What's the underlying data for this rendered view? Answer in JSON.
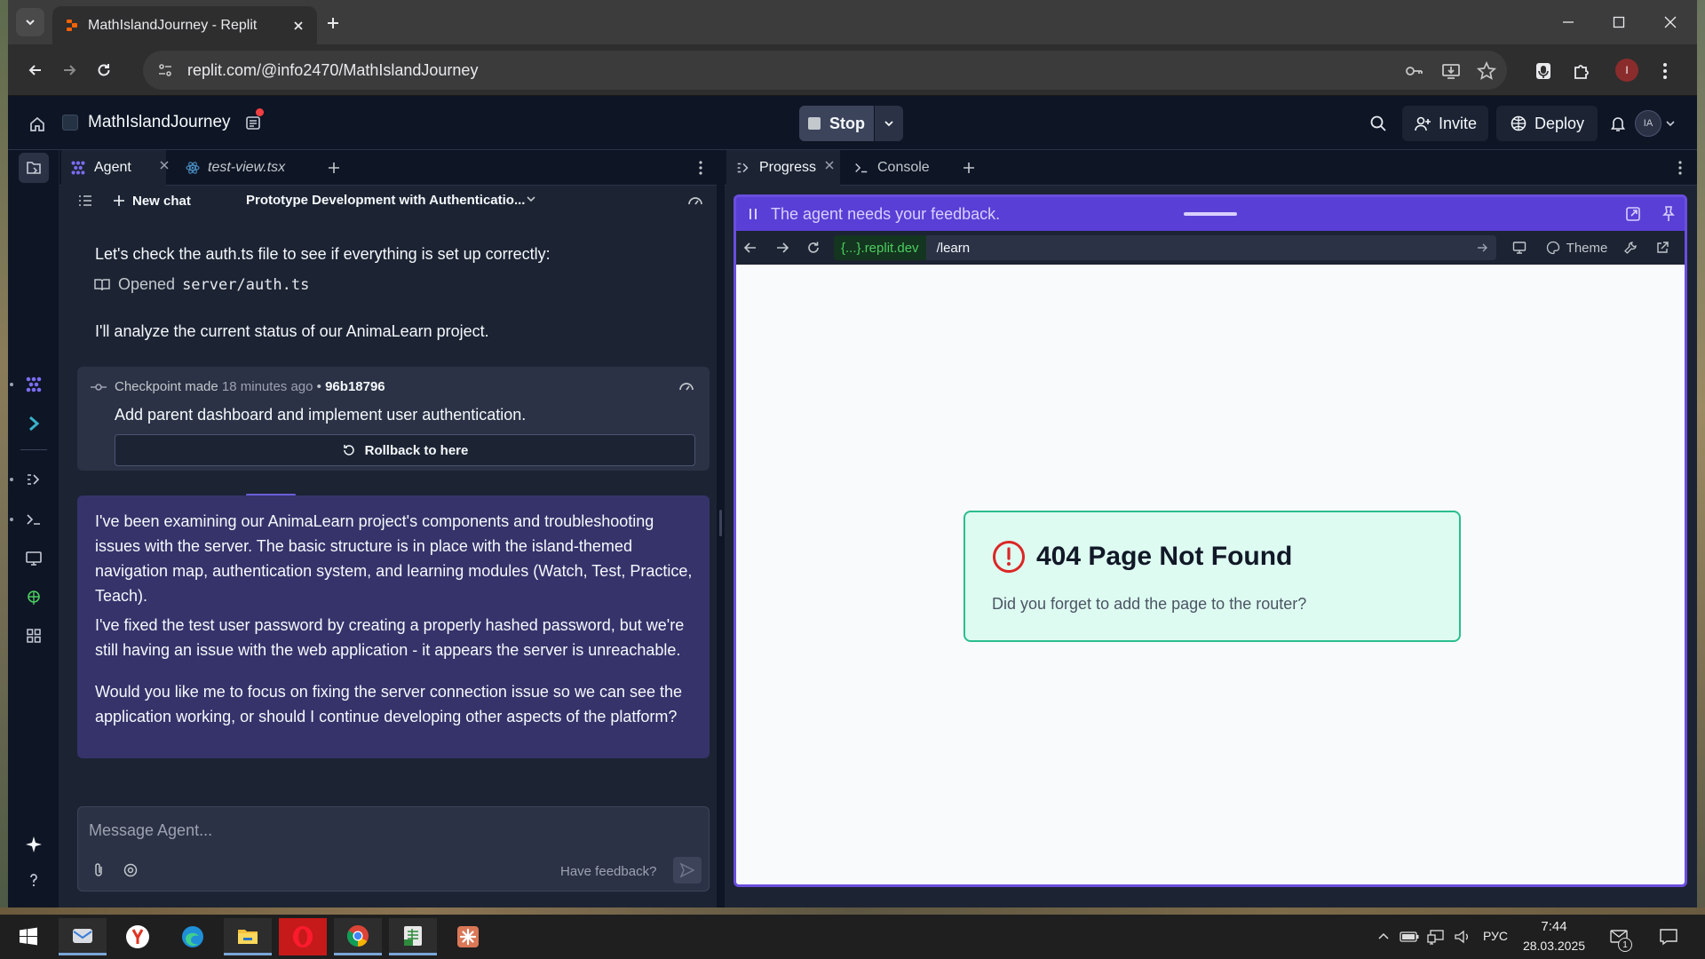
{
  "browser": {
    "tab_title": "MathIslandJourney - Replit",
    "url": "replit.com/@info2470/MathIslandJourney",
    "profile_initial": "I"
  },
  "replit_header": {
    "repl_name": "MathIslandJourney",
    "stop_label": "Stop",
    "invite_label": "Invite",
    "deploy_label": "Deploy",
    "avatar_initials": "IA"
  },
  "left_panel": {
    "tabs": [
      {
        "label": "Agent",
        "icon": "agent-icon"
      },
      {
        "label": "test-view.tsx",
        "icon": "react-file-icon"
      }
    ],
    "new_chat_label": "New chat",
    "chat_title": "Prototype Development with Authenticatio..."
  },
  "chat": {
    "msg_check": "Let's check the auth.ts file to see if everything is set up correctly:",
    "opened_label": "Opened",
    "opened_file": "server/auth.ts",
    "msg_analyze": "I'll analyze the current status of our AnimaLearn project.",
    "checkpoint": {
      "label": "Checkpoint made",
      "time": "18 minutes ago",
      "separator": "•",
      "hash": "96b18796",
      "description": "Add parent dashboard and implement user authentication.",
      "rollback_label": "Rollback to here"
    },
    "agent_message": [
      "I've been examining our AnimaLearn project's components and troubleshooting issues with the server. The basic structure is in place with the island-themed navigation map, authentication system, and learning modules (Watch, Test, Practice, Teach).",
      "I've fixed the test user password by creating a properly hashed password, but we're still having an issue with the web application - it appears the server is unreachable.",
      "Would you like me to focus on fixing the server connection issue so we can see the application working, or should I continue developing other aspects of the platform?"
    ]
  },
  "composer": {
    "placeholder": "Message Agent...",
    "feedback_label": "Have feedback?"
  },
  "right_panel": {
    "tabs": [
      {
        "label": "Progress",
        "icon": "progress-icon"
      },
      {
        "label": "Console",
        "icon": "terminal-icon"
      }
    ],
    "feedback_banner": "The agent needs your feedback.",
    "webview": {
      "host": "{...}.replit.dev",
      "path": "/learn",
      "theme_label": "Theme"
    },
    "page": {
      "title": "404 Page Not Found",
      "subtitle": "Did you forget to add the page to the router?"
    }
  },
  "taskbar": {
    "apps": [
      "start-icon",
      "mail-icon",
      "yandex-browser-icon",
      "edge-icon",
      "file-explorer-icon",
      "opera-icon",
      "chrome-icon",
      "spreadsheet-icon",
      "claude-icon"
    ],
    "language": "РУС",
    "time": "7:44",
    "date": "28.03.2025",
    "mail_count": "1"
  },
  "colors": {
    "replit_bg": "#1c2333",
    "replit_dark": "#0e1525",
    "agent_message_bg": "#36336b",
    "feedback_banner": "#5a3fd6",
    "not_found_card": "#ddfbf1",
    "not_found_border": "#2bbd8e",
    "error_red": "#dc2626",
    "url_host_green": "#4ccd60"
  }
}
